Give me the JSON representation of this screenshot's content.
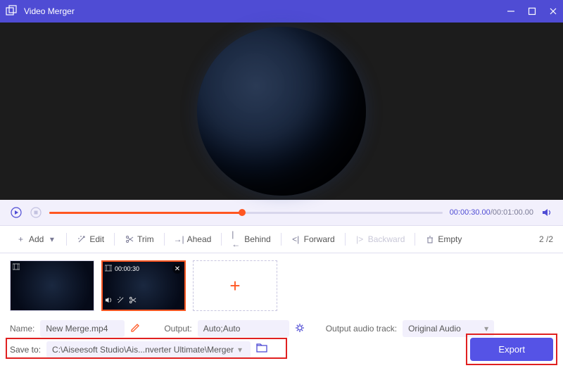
{
  "titlebar": {
    "title": "Video Merger"
  },
  "time": {
    "current": "00:00:30.00",
    "total": "00:01:00.00"
  },
  "toolbar": {
    "add": "Add",
    "edit": "Edit",
    "trim": "Trim",
    "ahead": "Ahead",
    "behind": "Behind",
    "forward": "Forward",
    "backward": "Backward",
    "empty": "Empty"
  },
  "page_count": "2 /2",
  "thumbs": {
    "selected_duration": "00:00:30"
  },
  "settings": {
    "name_label": "Name:",
    "name_value": "New Merge.mp4",
    "output_label": "Output:",
    "output_value": "Auto;Auto",
    "audio_label": "Output audio track:",
    "audio_value": "Original Audio",
    "saveto_label": "Save to:",
    "saveto_value": "C:\\Aiseesoft Studio\\Ais...nverter Ultimate\\Merger"
  },
  "export_label": "Export"
}
